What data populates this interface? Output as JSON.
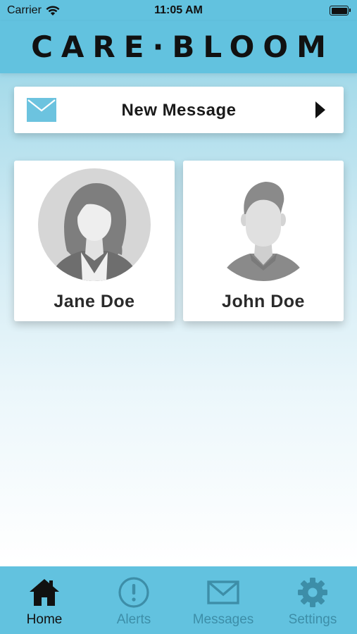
{
  "status_bar": {
    "carrier": "Carrier",
    "time": "11:05 AM"
  },
  "header": {
    "brand": "CARE·BLOOM"
  },
  "new_message": {
    "label": "New Message",
    "icon": "envelope-icon"
  },
  "contacts": [
    {
      "name": "Jane Doe",
      "avatar": "female-avatar"
    },
    {
      "name": "John Doe",
      "avatar": "male-avatar"
    }
  ],
  "tabs": [
    {
      "label": "Home",
      "icon": "home-icon",
      "active": true
    },
    {
      "label": "Alerts",
      "icon": "alert-icon",
      "active": false
    },
    {
      "label": "Messages",
      "icon": "envelope-icon",
      "active": false
    },
    {
      "label": "Settings",
      "icon": "gear-icon",
      "active": false
    }
  ],
  "colors": {
    "header": "#62c2df",
    "tab_inactive": "#3d8ea8",
    "tab_active": "#111111",
    "envelope": "#6cc3df"
  }
}
